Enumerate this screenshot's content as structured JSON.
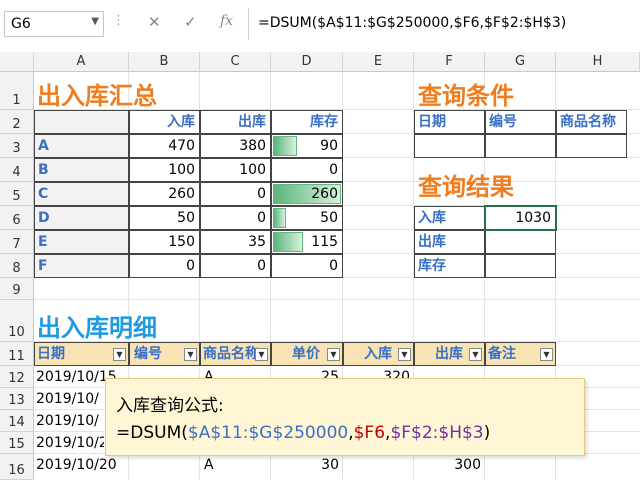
{
  "formula_bar": {
    "name_box": "G6",
    "cancel_icon": "✕",
    "enter_icon": "✓",
    "fx_label": "fx",
    "formula": "=DSUM($A$11:$G$250000,$F6,$F$2:$H$3)"
  },
  "columns": [
    "A",
    "B",
    "C",
    "D",
    "E",
    "F",
    "G",
    "H"
  ],
  "rows": [
    "1",
    "2",
    "3",
    "4",
    "5",
    "6",
    "7",
    "8",
    "9",
    "10",
    "11",
    "12",
    "13",
    "14",
    "15",
    "16"
  ],
  "summary": {
    "title": "出入库汇总",
    "headers": [
      "入库",
      "出库",
      "库存"
    ],
    "rows": [
      {
        "name": "A",
        "in": "470",
        "out": "380",
        "stock": "90",
        "stock_fraction": 0.35
      },
      {
        "name": "B",
        "in": "100",
        "out": "100",
        "stock": "0",
        "stock_fraction": 0
      },
      {
        "name": "C",
        "in": "260",
        "out": "0",
        "stock": "260",
        "stock_fraction": 1.0
      },
      {
        "name": "D",
        "in": "50",
        "out": "0",
        "stock": "50",
        "stock_fraction": 0.19
      },
      {
        "name": "E",
        "in": "150",
        "out": "35",
        "stock": "115",
        "stock_fraction": 0.44
      },
      {
        "name": "F",
        "in": "0",
        "out": "0",
        "stock": "0",
        "stock_fraction": 0
      }
    ]
  },
  "query": {
    "title": "查询条件",
    "headers": [
      "日期",
      "编号",
      "商品名称"
    ]
  },
  "result": {
    "title": "查询结果",
    "rows": [
      {
        "label": "入库",
        "value": "1030"
      },
      {
        "label": "出库",
        "value": ""
      },
      {
        "label": "库存",
        "value": ""
      }
    ]
  },
  "detail": {
    "title": "出入库明细",
    "headers": [
      "日期",
      "编号",
      "商品名称",
      "单价",
      "入库",
      "出库",
      "备注"
    ],
    "rows": [
      {
        "date": "2019/10/15",
        "id": "",
        "product": "A",
        "price": "25",
        "in": "320",
        "out": ""
      },
      {
        "date": "2019/10/",
        "id": "",
        "product": "",
        "price": "",
        "in": "",
        "out": ""
      },
      {
        "date": "2019/10/",
        "id": "",
        "product": "",
        "price": "",
        "in": "",
        "out": ""
      },
      {
        "date": "2019/10/2",
        "id": "",
        "product": "",
        "price": "",
        "in": "",
        "out": ""
      },
      {
        "date": "2019/10/20",
        "id": "",
        "product": "A",
        "price": "30",
        "in": "",
        "out": "300"
      }
    ]
  },
  "callout": {
    "label": "入库查询公式:",
    "f_prefix": "=DSUM(",
    "f_arg1": "$A$11:$G$250000",
    "f_comma1": ",",
    "f_arg2": "$F6",
    "f_comma2": ",",
    "f_arg3": "$F$2:$H$3",
    "f_suffix": ")",
    "colors": {
      "arg1": "#3b6fc6",
      "arg2": "#c00000",
      "arg3": "#7030a0"
    }
  }
}
